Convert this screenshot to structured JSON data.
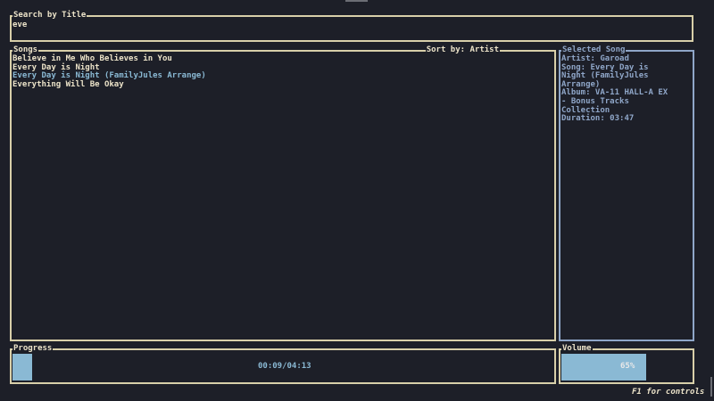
{
  "search": {
    "title": "Search by Title",
    "value": "eve"
  },
  "songs": {
    "title": "Songs",
    "sort_label": "Sort by: Artist",
    "items": [
      {
        "label": "Believe in Me Who Believes in You"
      },
      {
        "label": "Every Day is Night"
      },
      {
        "label": "Every Day is Night (FamilyJules Arrange)",
        "selected": true
      },
      {
        "label": "Everything Will Be Okay"
      }
    ]
  },
  "selected_song": {
    "title": "Selected Song",
    "artist": "Artist: Garoad",
    "song": "Song: Every Day is Night (FamilyJules Arrange)",
    "album": "Album: VA-11 HALL-A EX - Bonus Tracks Collection",
    "duration": "Duration: 03:47"
  },
  "progress": {
    "title": "Progress",
    "time": "00:09/04:13",
    "fraction": 0.036
  },
  "volume": {
    "title": "Volume",
    "label": "65%",
    "percent": 65
  },
  "footer": {
    "hint": "F1 for controls"
  },
  "colors": {
    "background": "#1d1f28",
    "border": "#d8cfa9",
    "accent_border": "#8fa6c8",
    "highlight": "#8ab9d4",
    "text": "#ece3c9"
  }
}
